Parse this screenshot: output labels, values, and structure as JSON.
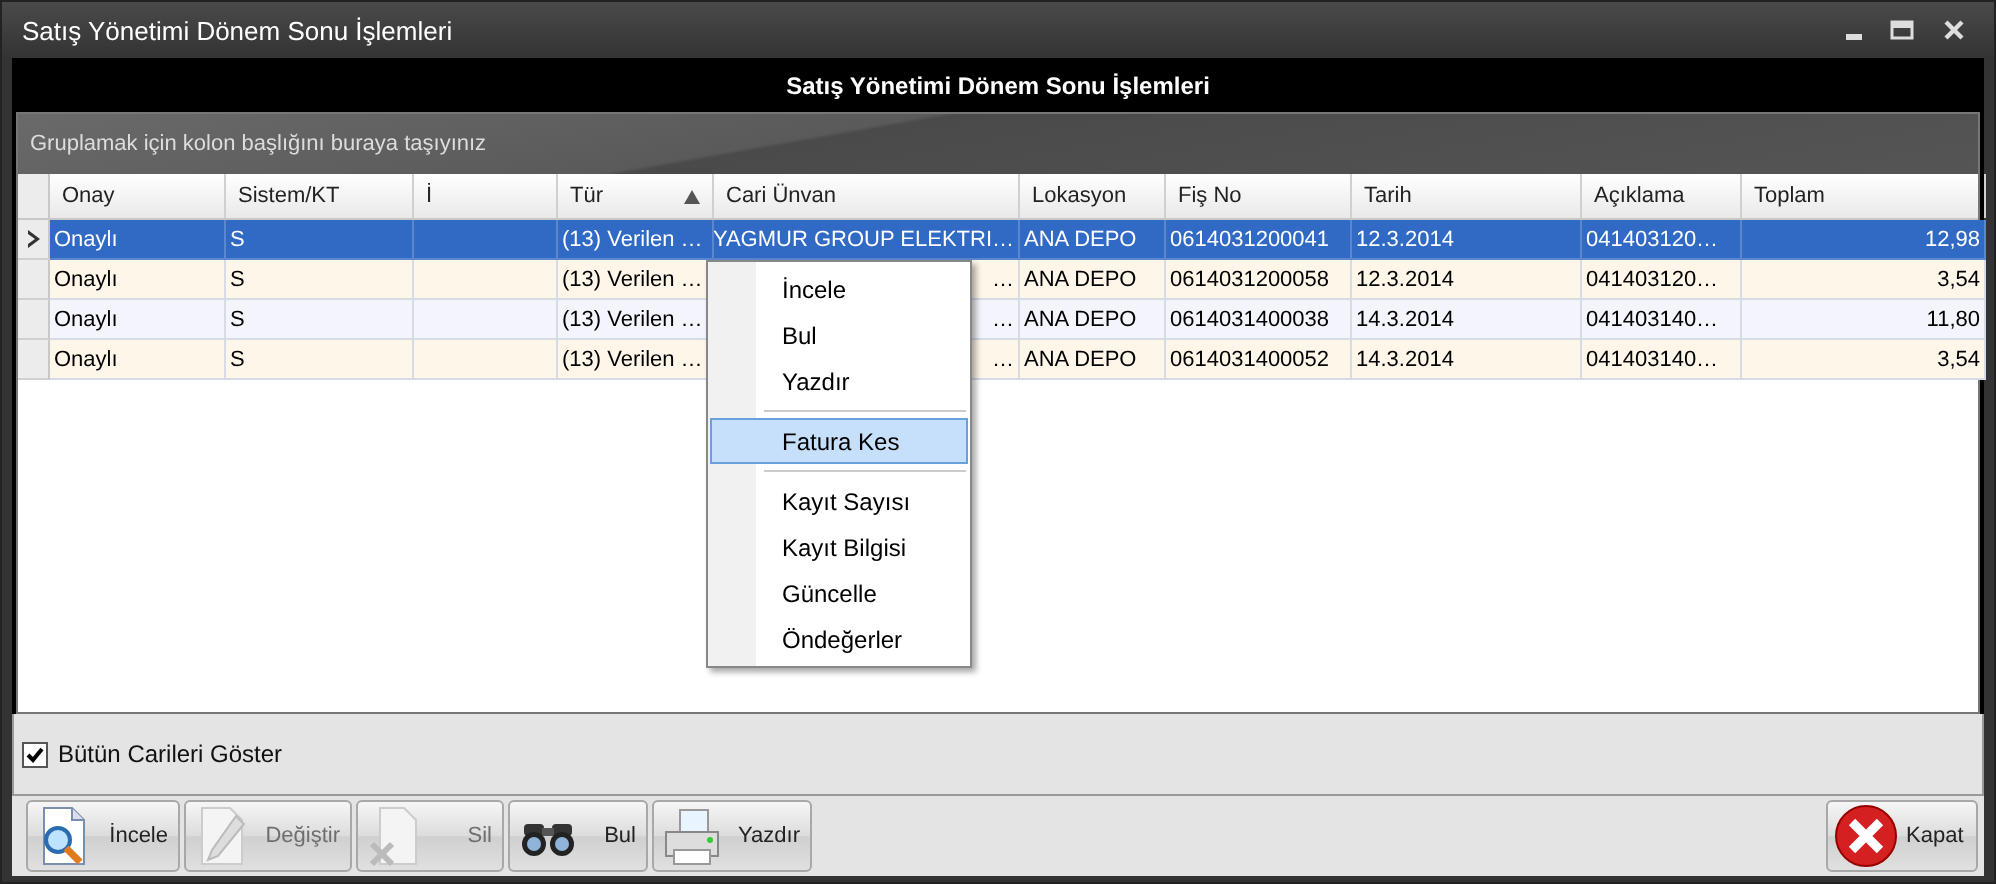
{
  "window": {
    "title": "Satış Yönetimi Dönem Sonu İşlemleri"
  },
  "header": {
    "title": "Satış Yönetimi Dönem Sonu İşlemleri"
  },
  "group_panel": {
    "hint": "Gruplamak için kolon başlığını buraya taşıyınız"
  },
  "table": {
    "columns": [
      {
        "label": "Onay",
        "sorted": false
      },
      {
        "label": "Sistem/KT",
        "sorted": false
      },
      {
        "label": "İ",
        "sorted": false
      },
      {
        "label": "Tür",
        "sorted": true
      },
      {
        "label": "Cari Ünvan",
        "sorted": false
      },
      {
        "label": "Lokasyon",
        "sorted": false
      },
      {
        "label": "Fiş No",
        "sorted": false
      },
      {
        "label": "Tarih",
        "sorted": false
      },
      {
        "label": "Açıklama",
        "sorted": false
      },
      {
        "label": "Toplam",
        "sorted": false
      }
    ],
    "rows": [
      {
        "selected": true,
        "onay": "Onaylı",
        "sistem": "S",
        "tur": "(13) Verilen …",
        "cari": "YAGMUR GROUP ELEKTRI…",
        "lokasyon": "ANA DEPO",
        "fis_no": "0614031200041",
        "tarih": "12.3.2014",
        "aciklama": "041403120…",
        "toplam": "12,98"
      },
      {
        "selected": false,
        "onay": "Onaylı",
        "sistem": "S",
        "tur": "(13) Verilen …",
        "cari": "…",
        "lokasyon": "ANA DEPO",
        "fis_no": "0614031200058",
        "tarih": "12.3.2014",
        "aciklama": "041403120…",
        "toplam": "3,54"
      },
      {
        "selected": false,
        "onay": "Onaylı",
        "sistem": "S",
        "tur": "(13) Verilen …",
        "cari": "…",
        "lokasyon": "ANA DEPO",
        "fis_no": "0614031400038",
        "tarih": "14.3.2014",
        "aciklama": "041403140…",
        "toplam": "11,80"
      },
      {
        "selected": false,
        "onay": "Onaylı",
        "sistem": "S",
        "tur": "(13) Verilen …",
        "cari": "…",
        "lokasyon": "ANA DEPO",
        "fis_no": "0614031400052",
        "tarih": "14.3.2014",
        "aciklama": "041403140…",
        "toplam": "3,54"
      }
    ]
  },
  "context_menu": {
    "items": [
      {
        "kind": "item",
        "label": "İncele",
        "selected": false
      },
      {
        "kind": "item",
        "label": "Bul",
        "selected": false
      },
      {
        "kind": "item",
        "label": "Yazdır",
        "selected": false
      },
      {
        "kind": "separator"
      },
      {
        "kind": "item",
        "label": "Fatura Kes",
        "selected": true
      },
      {
        "kind": "separator"
      },
      {
        "kind": "item",
        "label": "Kayıt Sayısı",
        "selected": false
      },
      {
        "kind": "item",
        "label": "Kayıt Bilgisi",
        "selected": false
      },
      {
        "kind": "item",
        "label": "Güncelle",
        "selected": false
      },
      {
        "kind": "item",
        "label": "Öndeğerler",
        "selected": false
      }
    ]
  },
  "options": {
    "label": "Bütün Carileri Göster",
    "checked": true
  },
  "toolbar": {
    "buttons": [
      {
        "label": "İncele",
        "disabled": false
      },
      {
        "label": "Değiştir",
        "disabled": true
      },
      {
        "label": "Sil",
        "disabled": true
      },
      {
        "label": "Bul",
        "disabled": false
      },
      {
        "label": "Yazdır",
        "disabled": false
      }
    ],
    "close_button": {
      "label": "Kapat",
      "disabled": false
    }
  }
}
